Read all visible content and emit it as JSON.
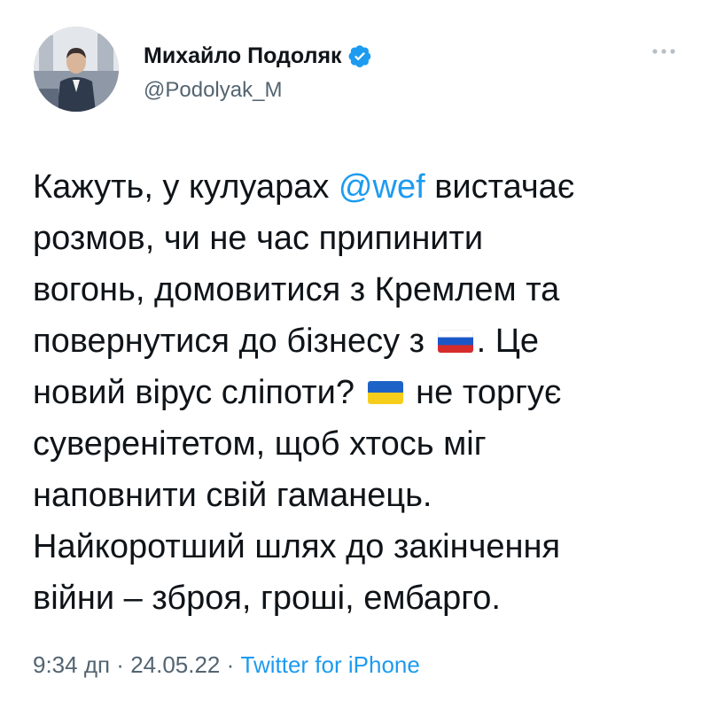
{
  "author": {
    "display_name": "Михайло Подоляк",
    "handle": "@Podolyak_M",
    "verified": true,
    "avatar_icon": "profile-photo"
  },
  "tweet": {
    "line1_before": "Кажуть, у кулуарах ",
    "line1_mention": "@wef",
    "line1_after": " вистачає",
    "line2": "розмов, чи не час припинити",
    "line3": "вогонь, домовитися з Кремлем та",
    "line4_before": "повернутися до бізнесу з ",
    "line4_flag": "russia-flag",
    "line4_after": ". Це",
    "line5_before": "новий вірус сліпоти? ",
    "line5_flag": "ukraine-flag",
    "line5_after": " не торгує",
    "line6": "суверенітетом, щоб хтось міг",
    "line7": "наповнити свій гаманець.",
    "line8": "Найкоротший шлях до закінчення",
    "line9": "війни – зброя, гроші, ембарго."
  },
  "meta": {
    "time": "9:34 дп",
    "separator": " · ",
    "date": "24.05.22",
    "source": "Twitter for iPhone"
  },
  "colors": {
    "text": "#0f1419",
    "secondary": "#536471",
    "link": "#1d9bf0",
    "verified": "#1d9bf0"
  }
}
